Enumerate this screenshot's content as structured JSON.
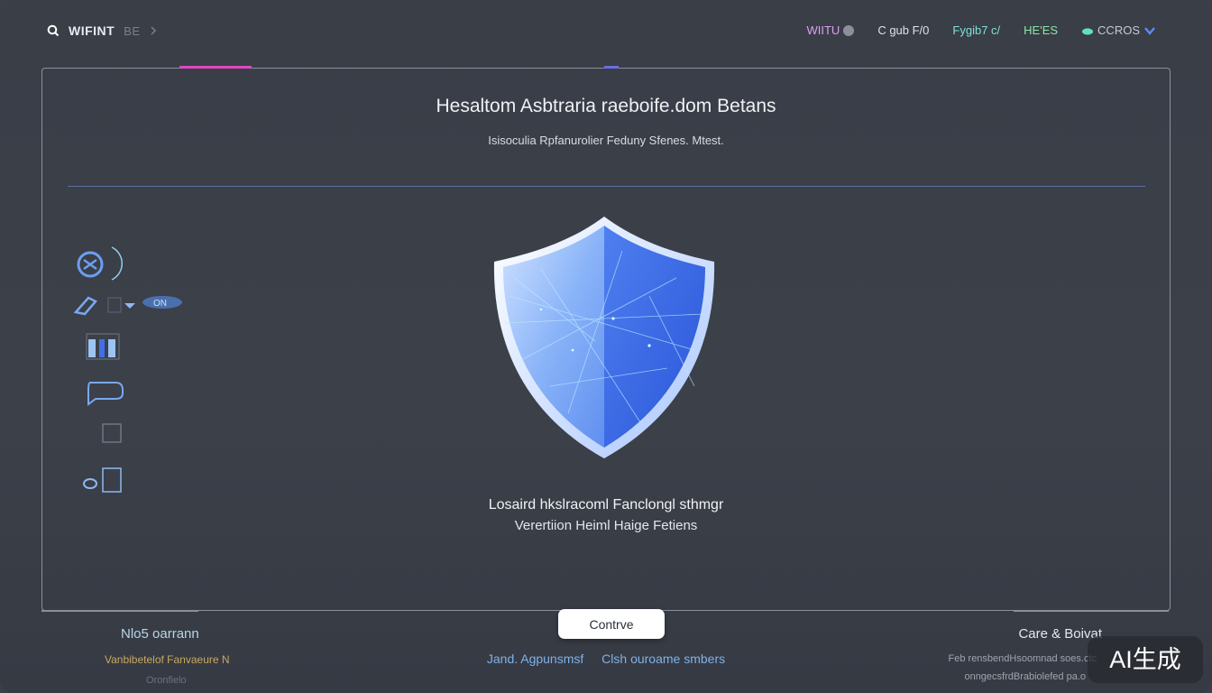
{
  "header": {
    "brand": "WIFINT",
    "brand_sub": "BE",
    "nav": [
      {
        "label": "WIITU",
        "color": "#d9a0f0"
      },
      {
        "label": "C gub F/0",
        "color": "#e0e2e6"
      },
      {
        "label": "Fygib7 c/",
        "color": "#7de0d6"
      },
      {
        "label": "HE'ES",
        "color": "#8fe3a8"
      },
      {
        "label": "CCROS",
        "color": "#c7cad2"
      }
    ]
  },
  "main": {
    "title": "Hesaltom Asbtraria raeboife.dom Betans",
    "subtitle": "Isisoculia Rpfanurolier Feduny Sfenes. Mtest.",
    "message_line1": "Losaird hkslracoml Fanclongl sthmgr",
    "message_line2": "Verertiion Heiml Haige Fetiens",
    "continue_label": "Contrve"
  },
  "sidebar": {
    "icons": [
      "link-icon",
      "tag-icon",
      "grid-icon",
      "chat-icon",
      "square-icon",
      "document-icon"
    ]
  },
  "footer": {
    "left_title": "Nlo5 oarrann",
    "left_sub": "Vanbibetelof Fanvaeure N",
    "left_line": "Oronfielo",
    "center_links": [
      "Jand. Agpunsmsf",
      "Clsh ouroame smbers"
    ],
    "right_title": "Care & Boivat",
    "right_sub": "Feb rensbendHsoomnad soes.ctc",
    "right_line": "onngecsfrdBrabiolefed pa.o"
  },
  "watermark": "AI生成",
  "colors": {
    "background": "#3b3f48",
    "frame": "#8a8f9b",
    "accent_pink": "#e04ac0",
    "shield_blue": "#3f6ee8",
    "link": "#7fb1e8"
  }
}
